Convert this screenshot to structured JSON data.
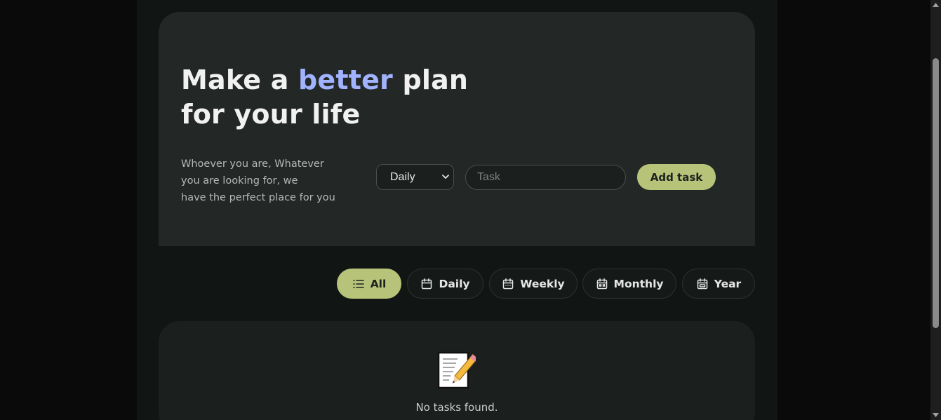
{
  "hero": {
    "headline_part1": "Make a ",
    "headline_accent": "better",
    "headline_part2": " plan",
    "headline_line2": "for your life",
    "tagline_lines": [
      "Whoever you are, Whatever",
      "you are looking for, we",
      "have the perfect place for you"
    ]
  },
  "form": {
    "period_selected": "Daily",
    "task_placeholder": "Task",
    "task_value": "",
    "add_button_label": "Add task"
  },
  "filters": [
    {
      "label": "All",
      "icon": "list-icon",
      "active": true
    },
    {
      "label": "Daily",
      "icon": "calendar-icon",
      "active": false
    },
    {
      "label": "Weekly",
      "icon": "calendar-icon",
      "active": false
    },
    {
      "label": "Monthly",
      "icon": "calendar-dots-icon",
      "active": false
    },
    {
      "label": "Year",
      "icon": "calendar-range-icon",
      "active": false
    }
  ],
  "empty_state": {
    "icon": "memo-icon",
    "message": "No tasks found."
  },
  "colors": {
    "accent": "#b8c37a",
    "headline_highlight": "#a1b2ff",
    "hero_bg": "#232826",
    "page_bg": "#111614"
  }
}
